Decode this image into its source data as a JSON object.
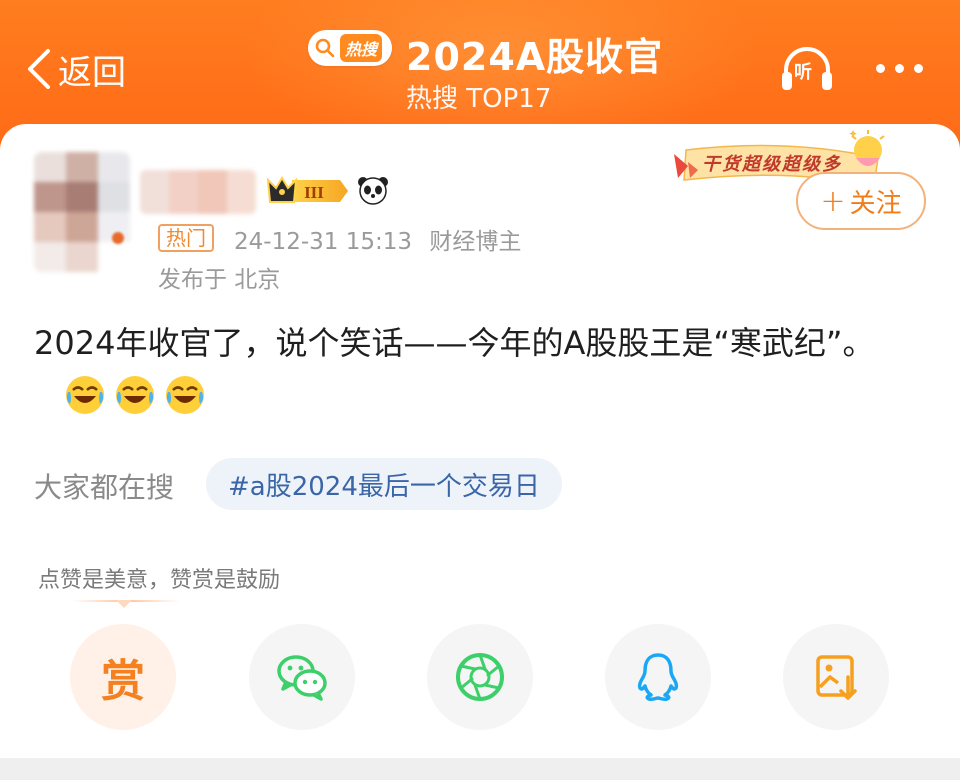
{
  "header": {
    "back_label": "返回",
    "hot_badge": "热搜",
    "title": "2024A股收官",
    "subtitle": "热搜 TOP17",
    "listen_label": "听"
  },
  "post": {
    "badge_label": "热门",
    "timestamp": "24-12-31 15:13",
    "author_type": "财经博主",
    "location": "发布于 北京",
    "vip_level": "III",
    "decor_text": "干货超级超级多",
    "follow_label": "关注",
    "follow_plus": "+",
    "content": "2024年收官了，说个笑话——今年的A股股王是“寒武纪”。"
  },
  "search": {
    "label": "大家都在搜",
    "chip": "#a股2024最后一个交易日"
  },
  "reward": {
    "hint": "点赞是美意，赞赏是鼓励",
    "button_glyph": "赏"
  },
  "colors": {
    "accent": "#ff6a1a",
    "follow": "#f07d1a",
    "link": "#3a66a8",
    "wechat": "#3ccf6a",
    "qq": "#1aa8f5"
  }
}
